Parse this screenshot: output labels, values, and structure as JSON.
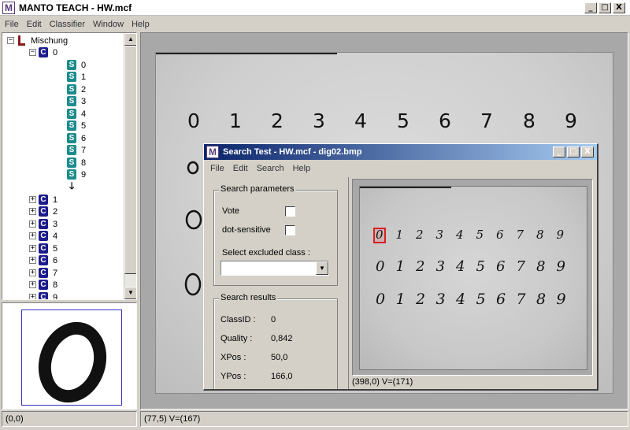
{
  "app": {
    "title": "MANTO TEACH - HW.mcf",
    "icon": "manto-logo-icon",
    "window_buttons": [
      "_",
      "□",
      "X"
    ]
  },
  "menu": [
    "File",
    "Edit",
    "Classifier",
    "Window",
    "Help"
  ],
  "tree": {
    "root": "Mischung",
    "expanded_class": "0",
    "samples": [
      "0",
      "1",
      "2",
      "3",
      "4",
      "5",
      "6",
      "7",
      "8",
      "9"
    ],
    "collapsed_classes": [
      "1",
      "2",
      "3",
      "4",
      "5",
      "6",
      "7",
      "8",
      "9"
    ]
  },
  "status": {
    "left": "(0,0)",
    "right": "(77,5)  V=(167)"
  },
  "main_image": {
    "printed_digits": [
      "0",
      "1",
      "2",
      "3",
      "4",
      "5",
      "6",
      "7",
      "8",
      "9"
    ]
  },
  "dialog": {
    "title": "Search Test - HW.mcf - dig02.bmp",
    "menu": [
      "File",
      "Edit",
      "Search",
      "Help"
    ],
    "params_legend": "Search parameters",
    "vote_label": "Vote",
    "vote_checked": false,
    "dot_label": "dot-sensitive",
    "dot_checked": false,
    "exclude_label": "Select excluded class :",
    "exclude_value": "",
    "results_legend": "Search results",
    "results": [
      {
        "label": "ClassID :",
        "value": "0"
      },
      {
        "label": "Quality :",
        "value": "0,842"
      },
      {
        "label": "XPos :",
        "value": "50,0"
      },
      {
        "label": "YPos :",
        "value": "166,0"
      }
    ],
    "status": "(398,0)  V=(171)",
    "hw_rows": [
      [
        "0",
        "1",
        "2",
        "3",
        "4",
        "5",
        "6",
        "7",
        "8",
        "9"
      ],
      [
        "0",
        "1",
        "2",
        "3",
        "4",
        "5",
        "6",
        "7",
        "8",
        "9"
      ],
      [
        "0",
        "1",
        "2",
        "3",
        "4",
        "5",
        "6",
        "7",
        "8",
        "9"
      ]
    ]
  },
  "colors": {
    "window_bg": "#d4d0c8",
    "dialog_title": "#0a246a",
    "class_icon": "#1c1c8c",
    "sample_icon": "#1c8c8c",
    "root_icon": "#8b1a1a",
    "match_marker": "#d82020"
  }
}
